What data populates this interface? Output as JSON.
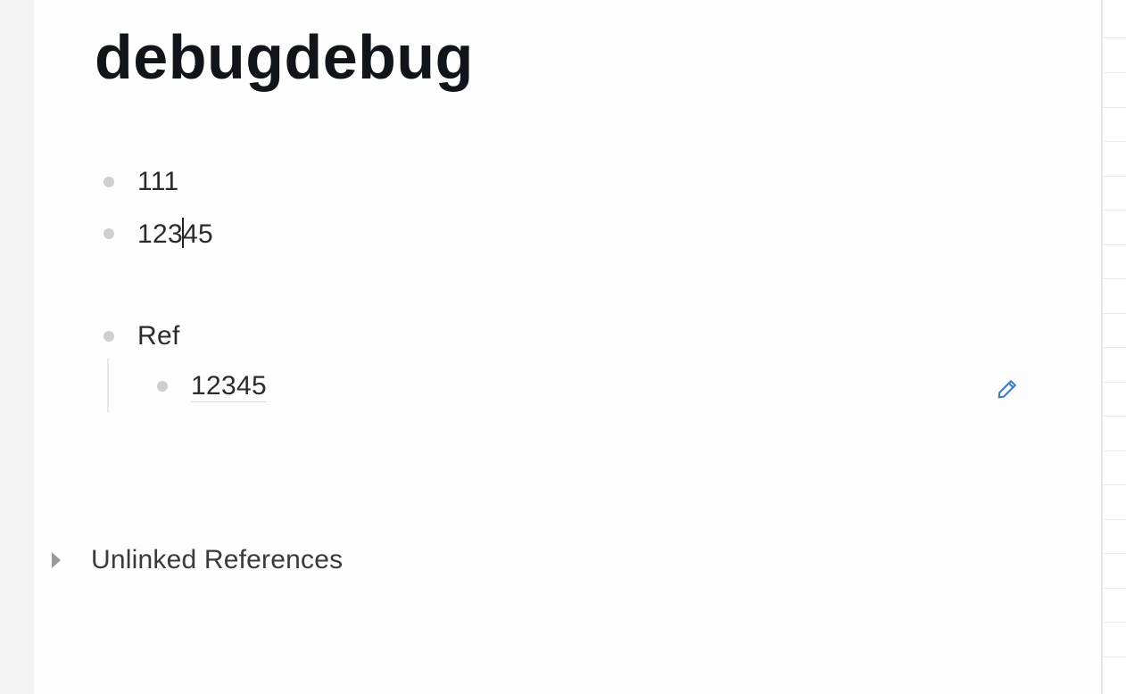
{
  "page": {
    "title": "debugdebug"
  },
  "blocks": [
    {
      "text": "111"
    },
    {
      "text_before_caret": "123",
      "text_after_caret": "45"
    },
    {
      "text": "Ref"
    }
  ],
  "ref_children": [
    {
      "text": "12345"
    }
  ],
  "actions": {
    "edit_icon": "pencil-icon"
  },
  "unlinked_references": {
    "label": "Unlinked References",
    "icon": "chevron-right-icon",
    "expanded": false
  },
  "colors": {
    "accent": "#3b7cc4",
    "bullet": "#cfcfcf",
    "text": "#2b2b2b"
  }
}
